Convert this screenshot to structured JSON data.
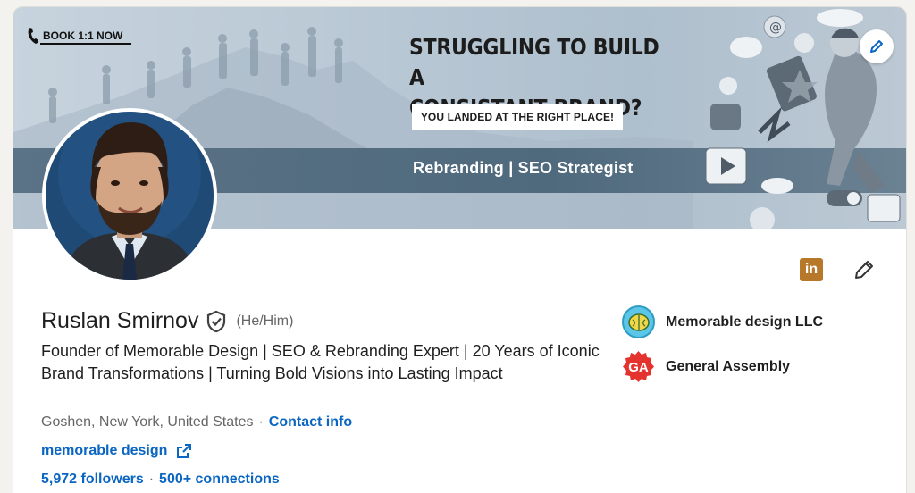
{
  "banner": {
    "book_label": "BOOK 1:1 NOW",
    "headline_line1": "STRUGGLING TO BUILD A",
    "headline_line2": "CONSISTANT BRAND?",
    "subline": "YOU LANDED AT THE RIGHT PLACE!",
    "stripe_text": "Rebranding | SEO Strategist"
  },
  "profile": {
    "name": "Ruslan Smirnov",
    "pronouns": "(He/Him)",
    "headline": "Founder of Memorable Design | SEO & Rebranding Expert | 20 Years of Iconic Brand Transformations | Turning Bold Visions into Lasting Impact",
    "location": "Goshen, New York, United States",
    "separator": "·",
    "contact_label": "Contact info",
    "website_label": "memorable design",
    "followers": "5,972 followers",
    "connections": "500+ connections"
  },
  "actions": {
    "linkedin_badge": "in"
  },
  "organizations": [
    {
      "name": "Memorable design LLC",
      "logo": "brain-icon"
    },
    {
      "name": "General Assembly",
      "logo": "ga-logo"
    }
  ],
  "org_logo_text": "GA",
  "colors": {
    "link": "#0a66c2",
    "linkedin_badge": "#b7782a",
    "ga_red": "#e4332e",
    "banner_stripe": "#4f697d"
  }
}
